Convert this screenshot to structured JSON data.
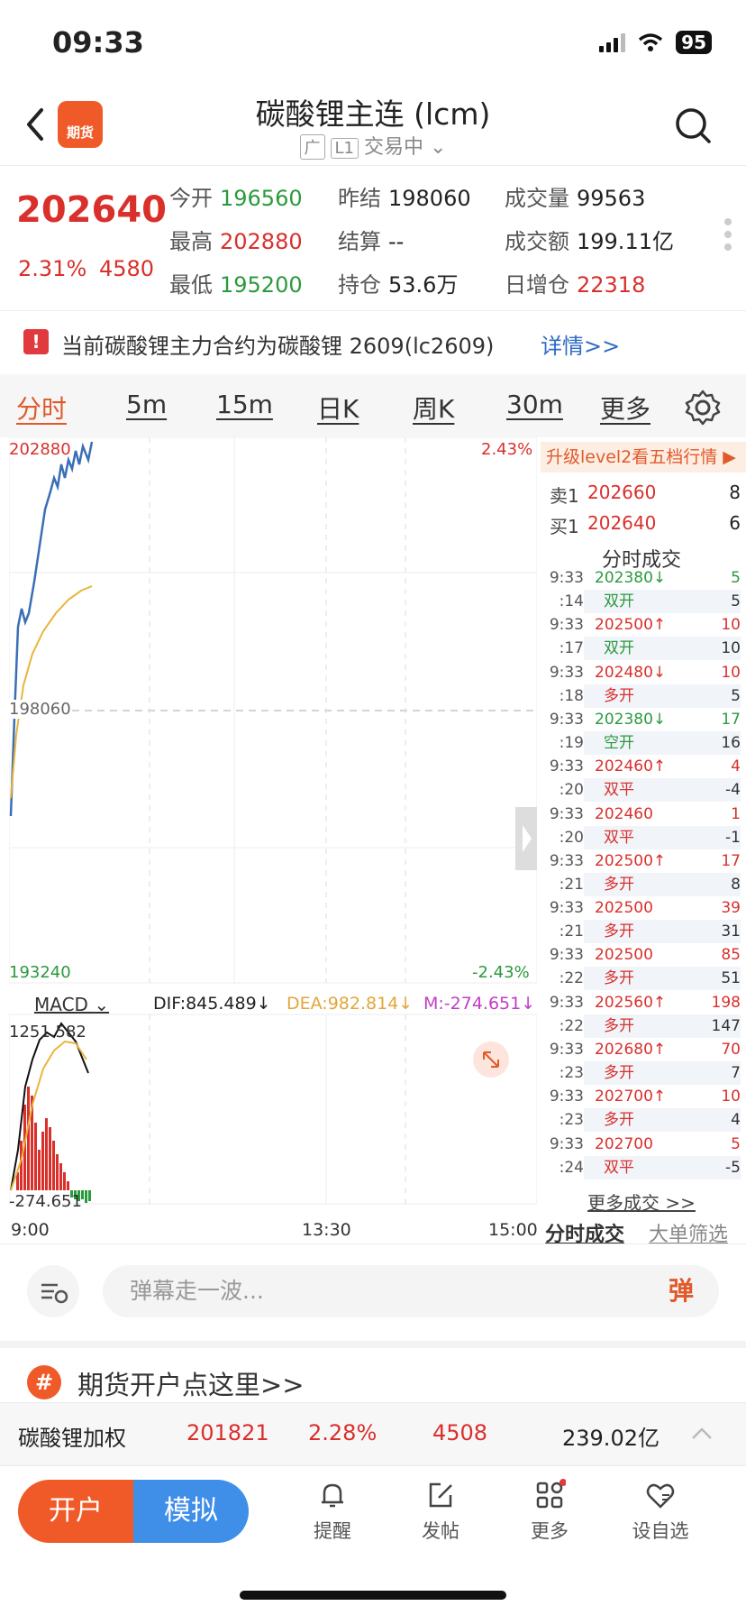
{
  "status_bar": {
    "time": "09:33",
    "battery": "95"
  },
  "header": {
    "logo_text": "期货",
    "title": "碳酸锂主连 (lcm)",
    "tag1": "广",
    "tag2": "L1",
    "trading_status": "交易中"
  },
  "quote": {
    "last_price": "202640",
    "change_pct": "2.31%",
    "change_abs": "4580",
    "open_label": "今开",
    "open": "196560",
    "prev_settle_label": "昨结",
    "prev_settle": "198060",
    "volume_label": "成交量",
    "volume": "99563",
    "high_label": "最高",
    "high": "202880",
    "settle_label": "结算",
    "settle": "--",
    "turnover_label": "成交额",
    "turnover": "199.11亿",
    "low_label": "最低",
    "low": "195200",
    "oi_label": "持仓",
    "oi": "53.6万",
    "oi_change_label": "日增仓",
    "oi_change": "22318"
  },
  "notice": {
    "icon": "!",
    "text": "当前碳酸锂主力合约为碳酸锂 2609(lc2609)",
    "link": "详情>>"
  },
  "tabs": [
    "分时",
    "5m",
    "15m",
    "日K",
    "周K",
    "30m",
    "更多"
  ],
  "chart": {
    "max_price": "202880",
    "max_pct": "2.43%",
    "ref_price": "198060",
    "min_price": "193240",
    "min_pct": "-2.43%",
    "times": [
      "9:00",
      "13:30",
      "15:00"
    ]
  },
  "macd": {
    "label": "MACD",
    "dif": "DIF:845.489↓",
    "dea": "DEA:982.814↓",
    "m": "M:-274.651↓",
    "top_value": "1251.582",
    "bottom_value": "-274.651"
  },
  "orderbook": {
    "level2_promo": "升级level2看五档行情 ▶",
    "ask_label": "卖1",
    "ask_price": "202660",
    "ask_vol": "8",
    "bid_label": "买1",
    "bid_price": "202640",
    "bid_vol": "6",
    "ticks_title": "分时成交"
  },
  "ticks": [
    {
      "time": "9:33",
      "sec": ":14",
      "price": "202380↓",
      "kind": "双开",
      "vol": "5",
      "oi": "5",
      "dir": "down"
    },
    {
      "time": "9:33",
      "sec": ":17",
      "price": "202500↑",
      "kind": "双开",
      "vol": "10",
      "oi": "10",
      "dir": "up"
    },
    {
      "time": "9:33",
      "sec": ":18",
      "price": "202480↓",
      "kind": "多开",
      "vol": "10",
      "oi": "5",
      "dir": "up"
    },
    {
      "time": "9:33",
      "sec": ":19",
      "price": "202380↓",
      "kind": "空开",
      "vol": "17",
      "oi": "16",
      "dir": "down"
    },
    {
      "time": "9:33",
      "sec": ":20",
      "price": "202460↑",
      "kind": "双平",
      "vol": "4",
      "oi": "-4",
      "dir": "up"
    },
    {
      "time": "9:33",
      "sec": ":20",
      "price": "202460",
      "kind": "双平",
      "vol": "1",
      "oi": "-1",
      "dir": "up"
    },
    {
      "time": "9:33",
      "sec": ":21",
      "price": "202500↑",
      "kind": "多开",
      "vol": "17",
      "oi": "8",
      "dir": "up"
    },
    {
      "time": "9:33",
      "sec": ":21",
      "price": "202500",
      "kind": "多开",
      "vol": "39",
      "oi": "31",
      "dir": "up"
    },
    {
      "time": "9:33",
      "sec": ":22",
      "price": "202500",
      "kind": "多开",
      "vol": "85",
      "oi": "51",
      "dir": "up"
    },
    {
      "time": "9:33",
      "sec": ":22",
      "price": "202560↑",
      "kind": "多开",
      "vol": "198",
      "oi": "147",
      "dir": "up"
    },
    {
      "time": "9:33",
      "sec": ":23",
      "price": "202680↑",
      "kind": "多开",
      "vol": "70",
      "oi": "7",
      "dir": "up"
    },
    {
      "time": "9:33",
      "sec": ":23",
      "price": "202700↑",
      "kind": "多开",
      "vol": "10",
      "oi": "4",
      "dir": "up"
    },
    {
      "time": "9:33",
      "sec": ":24",
      "price": "202700",
      "kind": "双平",
      "vol": "5",
      "oi": "-5",
      "dir": "up"
    }
  ],
  "panel_footer": {
    "more": "更多成交 >>",
    "tab1": "分时成交",
    "tab2": "大单筛选"
  },
  "danmu": {
    "placeholder": "弹幕走一波...",
    "send": "弹"
  },
  "promo": {
    "icon": "#",
    "text": "期货开户点这里>>"
  },
  "weighted": {
    "name": "碳酸锂加权",
    "price": "201821",
    "pct": "2.28%",
    "chg": "4508",
    "turnover": "239.02亿"
  },
  "bottom_nav": {
    "open": "开户",
    "sim": "模拟",
    "items": [
      "提醒",
      "发帖",
      "更多",
      "设自选"
    ]
  },
  "colors": {
    "up": "#d9302c",
    "down": "#2b9a3d",
    "accent": "#f05a28",
    "blue": "#3f8ee8"
  }
}
